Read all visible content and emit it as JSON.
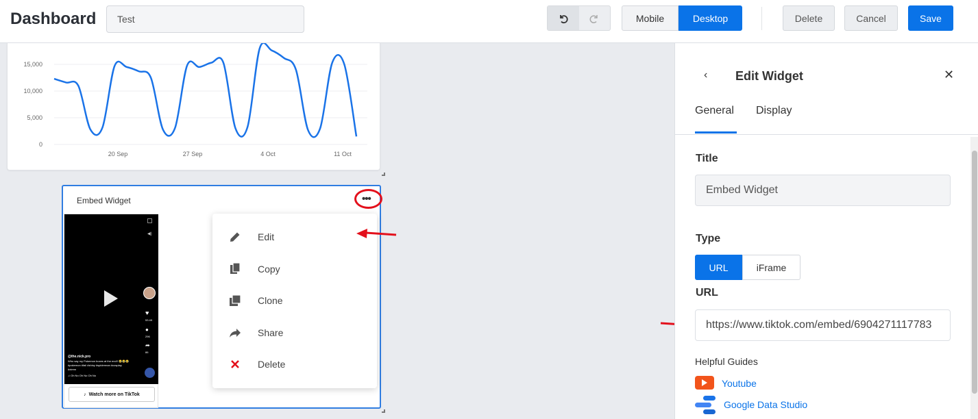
{
  "header": {
    "title": "Dashboard",
    "name_value": "Test",
    "undo_icon": "undo-icon",
    "redo_icon": "redo-icon",
    "view_mobile": "Mobile",
    "view_desktop": "Desktop",
    "active_view": "Desktop",
    "delete_label": "Delete",
    "cancel_label": "Cancel",
    "save_label": "Save"
  },
  "chart_data": {
    "type": "line",
    "y_ticks": [
      "15,000",
      "10,000",
      "5,000",
      "0"
    ],
    "x_ticks": [
      "20 Sep",
      "27 Sep",
      "4 Oct",
      "11 Oct"
    ],
    "ylim": [
      0,
      17500
    ],
    "color": "#1a73e8",
    "series": [
      {
        "values": [
          12300,
          11600,
          11000,
          2800,
          3200,
          14700,
          14500,
          13700,
          12500,
          2800,
          3100,
          14800,
          14500,
          15300,
          15300,
          3000,
          3300,
          18000,
          17600,
          16200,
          14000,
          2700,
          3000,
          15300,
          15000,
          1500
        ]
      }
    ]
  },
  "embed_widget": {
    "title": "Embed Widget",
    "menu_icon": "more-horizontal-icon",
    "tiktok": {
      "user": "@the.nick.pro",
      "caption": "Who say my Pokemon boxes at the end!! 😂😂😂 #pokemon #fail #shiny #spiderman #cosplay #xtrem",
      "music": "♫ Oh No  Oh No  Oh No",
      "likes": "53.4K",
      "comments": "296",
      "shares": "86",
      "watch_label": "Watch more on TikTok"
    }
  },
  "context_menu": {
    "items": [
      {
        "label": "Edit",
        "icon": "pencil-icon"
      },
      {
        "label": "Copy",
        "icon": "copy-icon"
      },
      {
        "label": "Clone",
        "icon": "clone-icon"
      },
      {
        "label": "Share",
        "icon": "share-icon"
      },
      {
        "label": "Delete",
        "icon": "x-icon",
        "color": "#e3101c"
      }
    ]
  },
  "panel": {
    "title": "Edit Widget",
    "tabs": [
      "General",
      "Display"
    ],
    "active_tab": "General",
    "title_label": "Title",
    "title_value": "Embed Widget",
    "type_label": "Type",
    "type_options": [
      "URL",
      "iFrame"
    ],
    "type_selected": "URL",
    "url_label": "URL",
    "url_value": "https://www.tiktok.com/embed/6904271117783",
    "guides_label": "Helpful Guides",
    "guides": [
      {
        "label": "Youtube",
        "icon": "youtube-icon"
      },
      {
        "label": "Google Data Studio",
        "icon": "google-data-studio-icon"
      }
    ]
  },
  "colors": {
    "accent": "#0a73e8",
    "annotation": "#e3101c"
  }
}
